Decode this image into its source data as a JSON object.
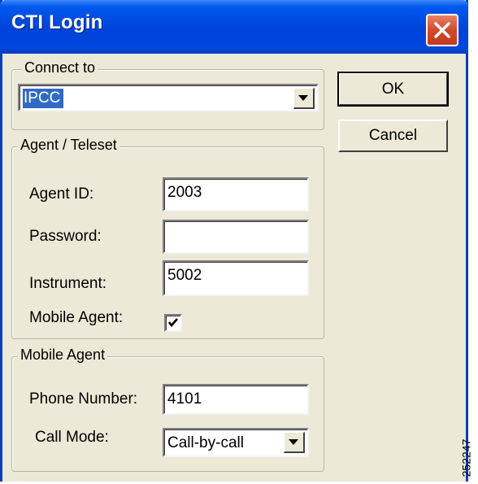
{
  "window": {
    "title": "CTI Login",
    "close_icon": "close-icon"
  },
  "connect": {
    "legend": "Connect to",
    "selected": "IPCC"
  },
  "buttons": {
    "ok": "OK",
    "cancel": "Cancel"
  },
  "agent": {
    "legend": "Agent / Teleset",
    "agent_id_label": "Agent ID:",
    "agent_id_value": "2003",
    "password_label": "Password:",
    "password_value": "",
    "instrument_label": "Instrument:",
    "instrument_value": "5002",
    "mobile_agent_label": "Mobile Agent:",
    "mobile_agent_checked": true
  },
  "mobile": {
    "legend": "Mobile Agent",
    "phone_label": "Phone Number:",
    "phone_value": "4101",
    "call_mode_label": "Call Mode:",
    "call_mode_value": "Call-by-call"
  },
  "watermark": "252247",
  "colors": {
    "titlebar": "#0046e0",
    "dialog": "#ece9d8",
    "selection": "#316ac5",
    "close": "#d3492c"
  }
}
